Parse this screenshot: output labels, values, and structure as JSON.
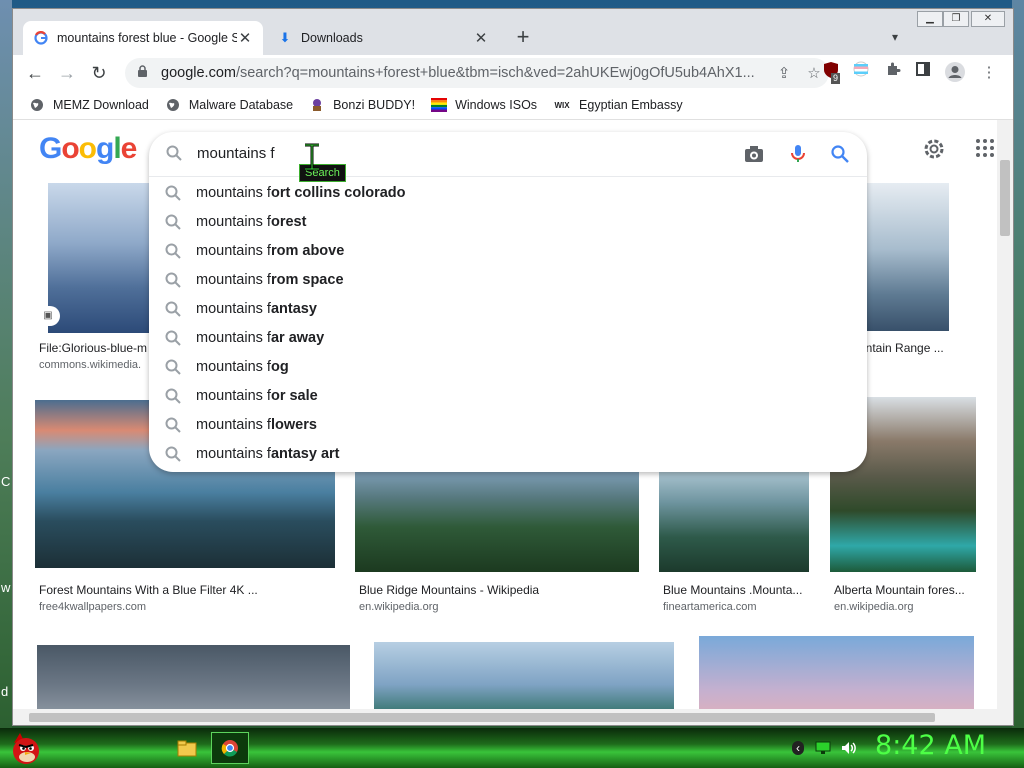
{
  "window": {
    "tabs": [
      {
        "title": "mountains forest blue - Google S",
        "active": true
      },
      {
        "title": "Downloads",
        "active": false
      }
    ]
  },
  "toolbar": {
    "url_host": "google.com",
    "url_rest": "/search?q=mountains+forest+blue&tbm=isch&ved=2ahUKEwj0gOfU5ub4AhX1...",
    "extension_badge": "9"
  },
  "bookmarks": [
    {
      "label": "MEMZ Download",
      "icon": "globe-icon"
    },
    {
      "label": "Malware Database",
      "icon": "globe-icon"
    },
    {
      "label": "Bonzi BUDDY!",
      "icon": "bonzi-icon"
    },
    {
      "label": "Windows ISOs",
      "icon": "rainbow-flag-icon"
    },
    {
      "label": "Egyptian Embassy",
      "icon": "wix-icon"
    }
  ],
  "search": {
    "query": "mountains f",
    "suggestions": [
      {
        "prefix": "mountains f",
        "bold": "ort collins colorado"
      },
      {
        "prefix": "mountains f",
        "bold": "orest"
      },
      {
        "prefix": "mountains f",
        "bold": "rom above"
      },
      {
        "prefix": "mountains f",
        "bold": "rom space"
      },
      {
        "prefix": "mountains f",
        "bold": "antasy"
      },
      {
        "prefix": "mountains f",
        "bold": "ar away"
      },
      {
        "prefix": "mountains f",
        "bold": "og"
      },
      {
        "prefix": "mountains f",
        "bold": "or sale"
      },
      {
        "prefix": "mountains f",
        "bold": "lowers"
      },
      {
        "prefix": "mountains f",
        "bold": "antasy art"
      }
    ],
    "tooltip": "Search"
  },
  "results": {
    "row1_left_caption": "File:Glorious-blue-m",
    "row1_left_source": "commons.wikimedia.",
    "row1_right_caption": "untain Range ...",
    "row2": [
      {
        "caption": "Forest Mountains With a Blue Filter 4K ...",
        "source": "free4kwallpapers.com"
      },
      {
        "caption": "Blue Ridge Mountains - Wikipedia",
        "source": "en.wikipedia.org"
      },
      {
        "caption": "Blue Mountains .Mounta...",
        "source": "fineartamerica.com"
      },
      {
        "caption": "Alberta Mountain fores...",
        "source": "en.wikipedia.org"
      }
    ]
  },
  "taskbar": {
    "clock": "8:42 AM"
  },
  "colors": {
    "google_blue": "#4285F4",
    "google_red": "#EA4335",
    "google_yellow": "#FBBC05",
    "google_green": "#34A853",
    "clock_green": "#4dff46"
  }
}
